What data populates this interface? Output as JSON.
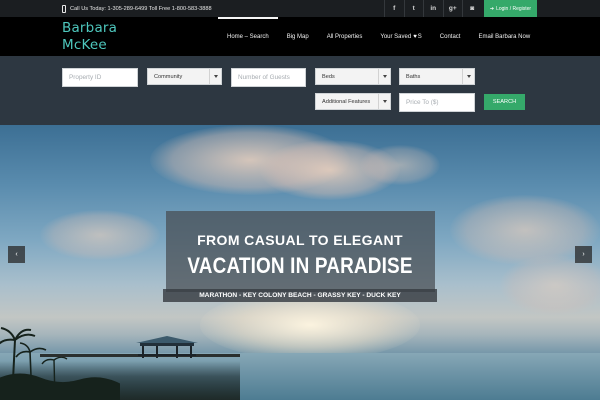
{
  "topbar": {
    "phone_text": "Call Us Today: 1-305-289-6499 Toll Free 1-800-583-3888",
    "social_icons": [
      "facebook-icon",
      "twitter-icon",
      "linkedin-icon",
      "google-plus-icon",
      "instagram-icon"
    ],
    "social_glyphs": [
      "f",
      "t",
      "in",
      "g+",
      "◙"
    ],
    "login_label": "Login / Register"
  },
  "header": {
    "logo_line1": "Barbara",
    "logo_line2": "McKee",
    "nav": [
      {
        "label": "Home – Search",
        "active": true
      },
      {
        "label": "Big Map"
      },
      {
        "label": "All Properties"
      },
      {
        "label_before": "Your Saved",
        "label_after": "S"
      },
      {
        "label": "Contact"
      },
      {
        "label": "Email Barbara Now"
      }
    ]
  },
  "search": {
    "property_id_placeholder": "Property ID",
    "community_label": "Community",
    "guests_placeholder": "Number of Guests",
    "beds_label": "Beds",
    "baths_label": "Baths",
    "features_label": "Additional Features",
    "price_placeholder": "Price To ($)",
    "search_button": "SEARCH"
  },
  "hero": {
    "line1": "FROM CASUAL TO ELEGANT",
    "line2": "VACATION IN PARADISE",
    "line3": "MARATHON - KEY COLONY BEACH - GRASSY KEY - DUCK KEY",
    "prev_glyph": "‹",
    "next_glyph": "›"
  },
  "colors": {
    "accent_green": "#35a96a",
    "logo_teal": "#4ec7bd",
    "search_panel": "#2d3741"
  }
}
